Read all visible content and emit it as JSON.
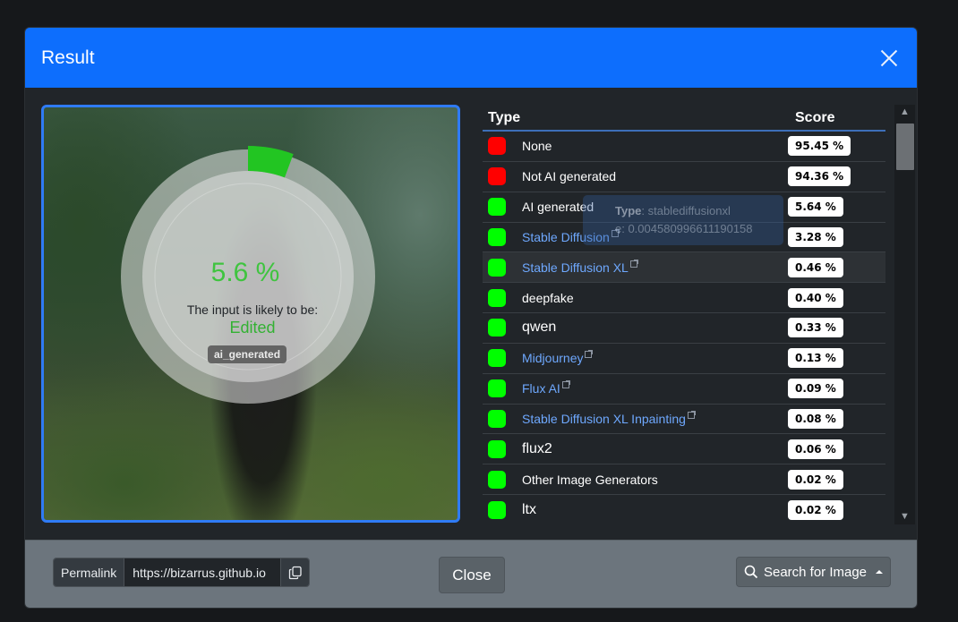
{
  "modal": {
    "title": "Result"
  },
  "gauge": {
    "percent": "5.6 %",
    "percent_value": 5.64,
    "label": "The input is likely to be:",
    "verdict": "Edited",
    "badge": "ai_generated",
    "arc_color": "#22c522"
  },
  "table": {
    "headers": {
      "type": "Type",
      "score": "Score"
    },
    "rows": [
      {
        "name": "None",
        "score": "95.45 %",
        "status": "red",
        "link": false
      },
      {
        "name": "Not AI generated",
        "score": "94.36 %",
        "status": "red",
        "link": false
      },
      {
        "name": "AI generated",
        "score": "5.64 %",
        "status": "green",
        "link": false
      },
      {
        "name": "Stable Diffusion",
        "score": "3.28 %",
        "status": "green",
        "link": true
      },
      {
        "name": "Stable Diffusion XL",
        "score": "0.46 %",
        "status": "green",
        "link": true
      },
      {
        "name": "deepfake",
        "score": "0.40 %",
        "status": "green",
        "link": false
      },
      {
        "name": "qwen",
        "score": "0.33 %",
        "status": "green",
        "link": false
      },
      {
        "name": "Midjourney",
        "score": "0.13 %",
        "status": "green",
        "link": true
      },
      {
        "name": "Flux AI",
        "score": "0.09 %",
        "status": "green",
        "link": true
      },
      {
        "name": "Stable Diffusion XL Inpainting",
        "score": "0.08 %",
        "status": "green",
        "link": true
      },
      {
        "name": "flux2",
        "score": "0.06 %",
        "status": "green",
        "link": false
      },
      {
        "name": "Other Image Generators",
        "score": "0.02 %",
        "status": "green",
        "link": false
      },
      {
        "name": "ltx",
        "score": "0.02 %",
        "status": "green",
        "link": false
      }
    ]
  },
  "tooltip": {
    "type_label": "Type",
    "type_value": ": stablediffusionxl",
    "value_line": "e: 0.004580996611190158"
  },
  "footer": {
    "permalink_label": "Permalink",
    "permalink_value": "https://bizarrus.github.io",
    "close_label": "Close",
    "search_label": "Search for Image"
  },
  "colors": {
    "header_blue": "#0d6efd",
    "red_status": "#ff0000",
    "green_status": "#00ff00",
    "link": "#6ea8fe"
  }
}
